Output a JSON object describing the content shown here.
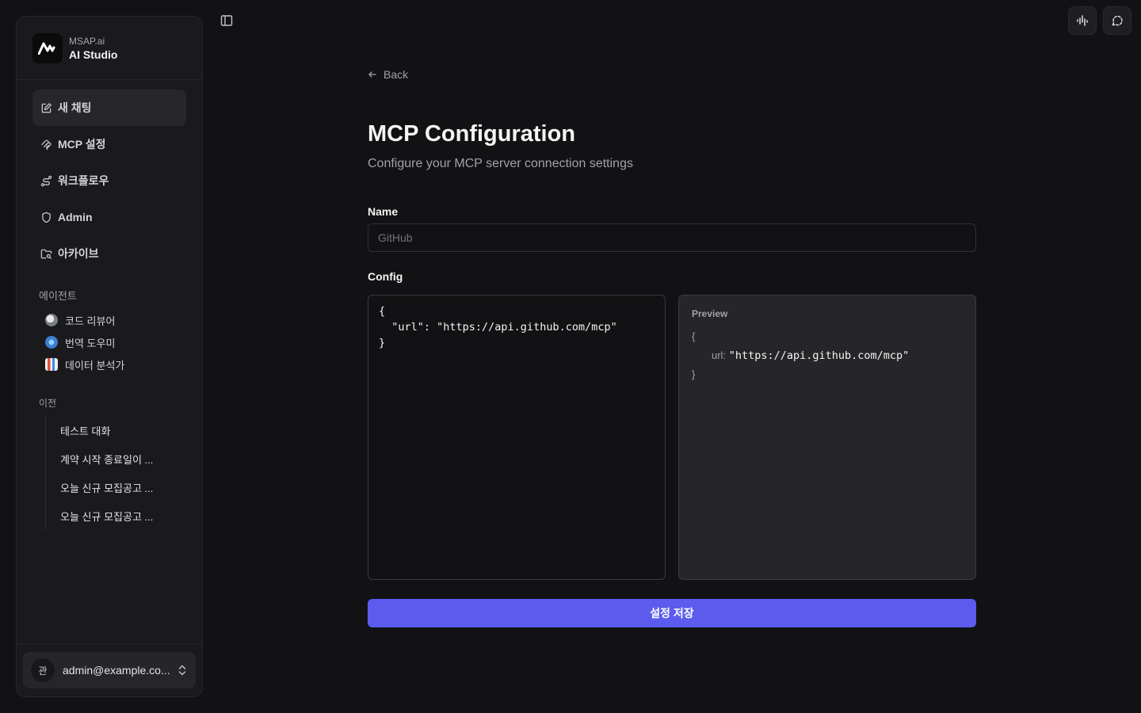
{
  "brand": {
    "org": "MSAP.ai",
    "app": "AI Studio"
  },
  "nav": {
    "new_chat": "새 채팅",
    "mcp_settings": "MCP 설정",
    "workflow": "워크플로우",
    "admin": "Admin",
    "archive": "아카이브"
  },
  "agents": {
    "label": "에이전트",
    "items": [
      {
        "name": "코드 리뷰어",
        "color": "#9aa0a6"
      },
      {
        "name": "번역 도우미",
        "color": "#4f8fd8"
      },
      {
        "name": "데이터 분석가",
        "color": "#e66a5c"
      }
    ]
  },
  "history": {
    "label": "이전",
    "items": [
      "테스트 대화",
      "계약 시작 종료일이 ...",
      "오늘 신규 모집공고 ...",
      "오늘 신규 모집공고 ..."
    ]
  },
  "user": {
    "initial": "관",
    "email": "admin@example.co..."
  },
  "main": {
    "back": "Back",
    "title": "MCP Configuration",
    "subtitle": "Configure your MCP server connection settings",
    "name_label": "Name",
    "name_placeholder": "GitHub",
    "config_label": "Config",
    "config_value": "{\n  \"url\": \"https://api.github.com/mcp\"\n}",
    "preview_label": "Preview",
    "preview_open": "{",
    "preview_key": "url:",
    "preview_value": "\"https://api.github.com/mcp\"",
    "preview_close": "}",
    "save_label": "설정 저장"
  },
  "colors": {
    "accent": "#5b5bee",
    "background": "#121214",
    "sidebar": "#1a1a1d"
  }
}
